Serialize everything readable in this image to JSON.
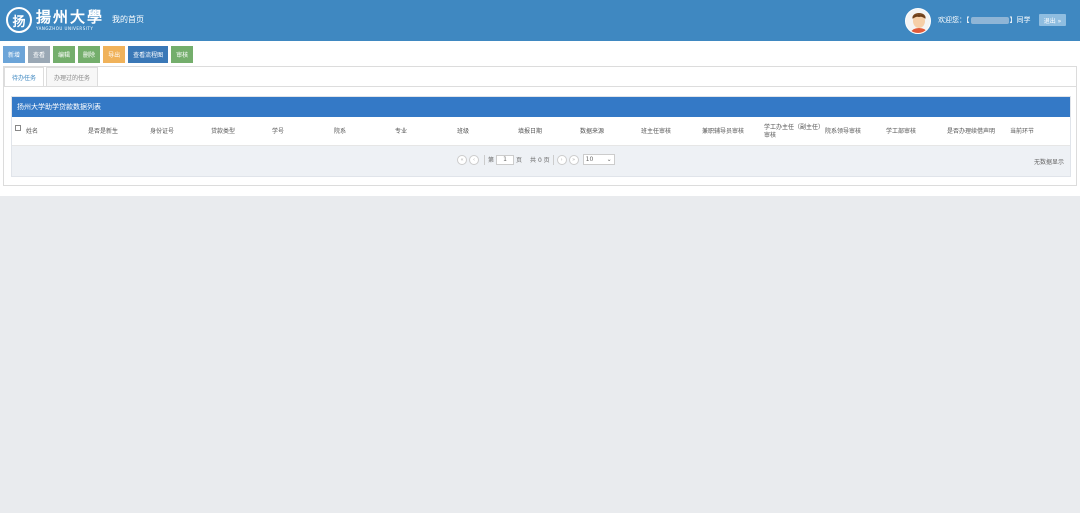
{
  "header": {
    "logo_cn": "揚州大學",
    "logo_en": "YANGZHOU UNIVERSITY",
    "logo_glyph": "扬",
    "nav_home": "我的首页",
    "welcome_prefix": "欢迎您：【",
    "welcome_suffix": "】同学",
    "logout_label": "退出 »"
  },
  "toolbar": {
    "buttons": [
      "新增",
      "查看",
      "编辑",
      "删除",
      "导出",
      "查看流程图",
      "审核"
    ]
  },
  "tabs": [
    "待办任务",
    "办理过的任务"
  ],
  "grid": {
    "title": "扬州大学助学贷款数据列表",
    "columns": [
      "姓名",
      "是否是新生",
      "身份证号",
      "贷款类型",
      "学号",
      "院系",
      "专业",
      "班级",
      "填报日期",
      "数据来源",
      "班主任审核",
      "兼职辅导员审核",
      "学工办主任（副主任）审核",
      "院系领导审核",
      "学工部审核",
      "是否办理续借声明",
      "当前环节"
    ]
  },
  "pager": {
    "page_prefix": "第",
    "page_value": "1",
    "page_suffix": "页",
    "total": "共 0 页",
    "page_size": "10",
    "no_data": "无数据显示"
  },
  "colors": {
    "header_bg": "#3f88c1",
    "grid_title_bg": "#3479c6"
  }
}
